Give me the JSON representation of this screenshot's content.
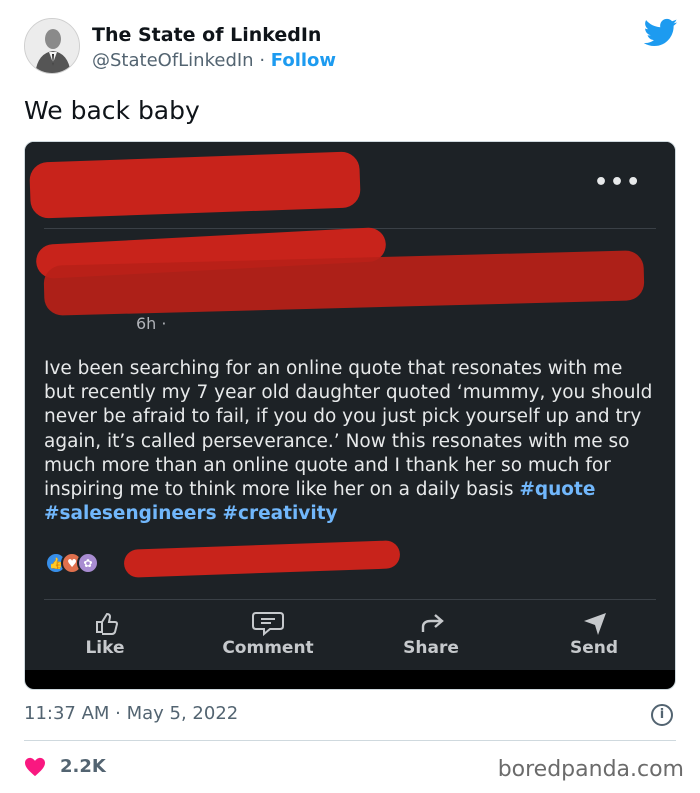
{
  "tweet": {
    "author_name": "The State of LinkedIn",
    "author_handle": "@StateOfLinkedIn",
    "handle_separator": " · ",
    "follow_label": "Follow",
    "text": "We back baby",
    "timestamp": "11:37 AM · May 5, 2022",
    "like_count": "2.2K",
    "brand_color": "#1d9bf0"
  },
  "screenshot": {
    "post_time": "6h ·",
    "body": "Ive been searching for an online quote that resonates with me but recently my 7 year old daughter quoted ‘mummy, you should never be afraid to fail, if you do you just pick yourself up and try again, it’s called perseverance.’ Now this resonates with me so much more than an online quote and I thank her so much for inspiring me to think more like her on a daily basis",
    "hashtags": [
      "#quote",
      "#salesengineers",
      "#creativity"
    ],
    "actions": [
      {
        "label": "Like",
        "icon": "thumbs-up-icon"
      },
      {
        "label": "Comment",
        "icon": "comment-icon"
      },
      {
        "label": "Share",
        "icon": "share-arrow-icon"
      },
      {
        "label": "Send",
        "icon": "send-icon"
      }
    ],
    "redaction_color": "#d9221a"
  },
  "footer": {
    "watermark": "boredpanda.com"
  }
}
